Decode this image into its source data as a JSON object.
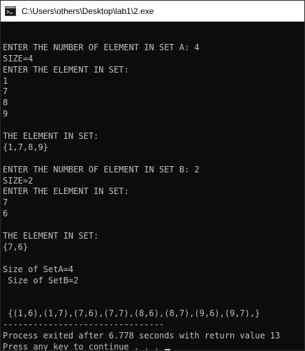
{
  "window": {
    "title": "C:\\Users\\others\\Desktop\\lab1\\2.exe",
    "icon": "console-app-icon"
  },
  "colors": {
    "background": "#0c0c0c",
    "text": "#c0c0c0",
    "titlebar": "#ffffff"
  },
  "console": {
    "lines": [
      "",
      "ENTER THE NUMBER OF ELEMENT IN SET A: 4",
      "SIZE=4",
      "ENTER THE ELEMENT IN SET:",
      "1",
      "7",
      "8",
      "9",
      "",
      "THE ELEMENT IN SET:",
      "{1,7,8,9}",
      "",
      "ENTER THE NUMBER OF ELEMENT IN SET B: 2",
      "SIZE=2",
      "ENTER THE ELEMENT IN SET:",
      "7",
      "6",
      "",
      "THE ELEMENT IN SET:",
      "{7,6}",
      "",
      "Size of SetA=4",
      " Size of SetB=2",
      "",
      "",
      " {(1,6),(1,7),(7,6),(7,7),(8,6),(8,7),(9,6),(9,7),}",
      "--------------------------------",
      "Process exited after 6.778 seconds with return value 13",
      "Press any key to continue . . . "
    ]
  }
}
